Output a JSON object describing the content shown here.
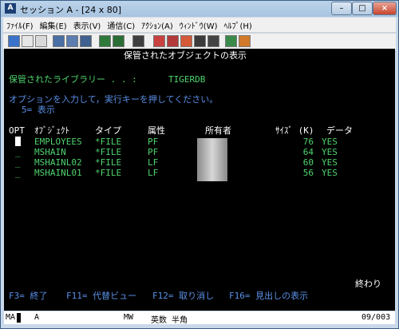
{
  "window": {
    "title": "セッション A - [24 x 80]",
    "icon_text": "A"
  },
  "menu": [
    "ﾌｧｲﾙ(F)",
    "編集(E)",
    "表示(V)",
    "通信(C)",
    "ｱｸｼｮﾝ(A)",
    "ｳｨﾝﾄﾞｳ(W)",
    "ﾍﾙﾌﾟ(H)"
  ],
  "screen": {
    "title": "保管されたオブジェクトの表示",
    "library_label": "保管されたライブラリー . . :",
    "library_value": "TIGERDB",
    "instructions": "オプションを入力して，実行キーを押してください。",
    "option_5": "5= 表示",
    "headers": {
      "opt": "OPT",
      "object": "ｵﾌﾞｼﾞｪｸﾄ",
      "type": "タイプ",
      "attr": "属性",
      "owner": "所有者",
      "size": "ｻｲｽﾞ (K)",
      "data": "データ"
    },
    "rows": [
      {
        "opt": "",
        "object": "EMPLOYEES",
        "type": "*FILE",
        "attr": "PF",
        "size": "76",
        "data": "YES"
      },
      {
        "opt": "_",
        "object": "MSHAIN",
        "type": "*FILE",
        "attr": "PF",
        "size": "64",
        "data": "YES"
      },
      {
        "opt": "_",
        "object": "MSHAINL02",
        "type": "*FILE",
        "attr": "LF",
        "size": "60",
        "data": "YES"
      },
      {
        "opt": "_",
        "object": "MSHAINL01",
        "type": "*FILE",
        "attr": "LF",
        "size": "56",
        "data": "YES"
      }
    ],
    "end_text": "終わり",
    "fkeys": [
      "F3= 終了",
      "F11= 代替ビュー",
      "F12= 取り消し",
      "F16= 見出しの表示"
    ]
  },
  "status": {
    "ma": "MA",
    "session": "A",
    "mw": "MW",
    "mode": "英数 半角",
    "position": "09/003"
  },
  "colors": {
    "green": "#4fd36e",
    "blue": "#5a8fe6",
    "white": "#ffffff"
  }
}
